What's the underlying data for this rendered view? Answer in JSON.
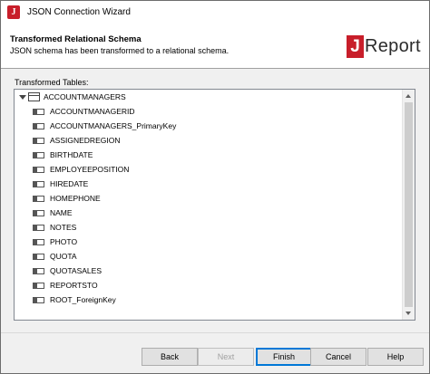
{
  "window": {
    "title": "JSON Connection Wizard",
    "app_icon_letter": "J"
  },
  "header": {
    "title": "Transformed Relational Schema",
    "subtitle": "JSON schema has been transformed to a relational schema.",
    "logo_j": "J",
    "logo_word": "Report"
  },
  "body": {
    "label": "Transformed Tables:",
    "tree": {
      "root": "ACCOUNTMANAGERS",
      "fields": [
        "ACCOUNTMANAGERID",
        "ACCOUNTMANAGERS_PrimaryKey",
        "ASSIGNEDREGION",
        "BIRTHDATE",
        "EMPLOYEEPOSITION",
        "HIREDATE",
        "HOMEPHONE",
        "NAME",
        "NOTES",
        "PHOTO",
        "QUOTA",
        "QUOTASALES",
        "REPORTSTO",
        "ROOT_ForeignKey"
      ]
    }
  },
  "footer": {
    "back_label": "Back",
    "next_label": "Next",
    "finish_label": "Finish",
    "cancel_label": "Cancel",
    "help_label": "Help"
  },
  "colors": {
    "brand_red": "#c81e2a",
    "focus_blue": "#0078d7"
  }
}
